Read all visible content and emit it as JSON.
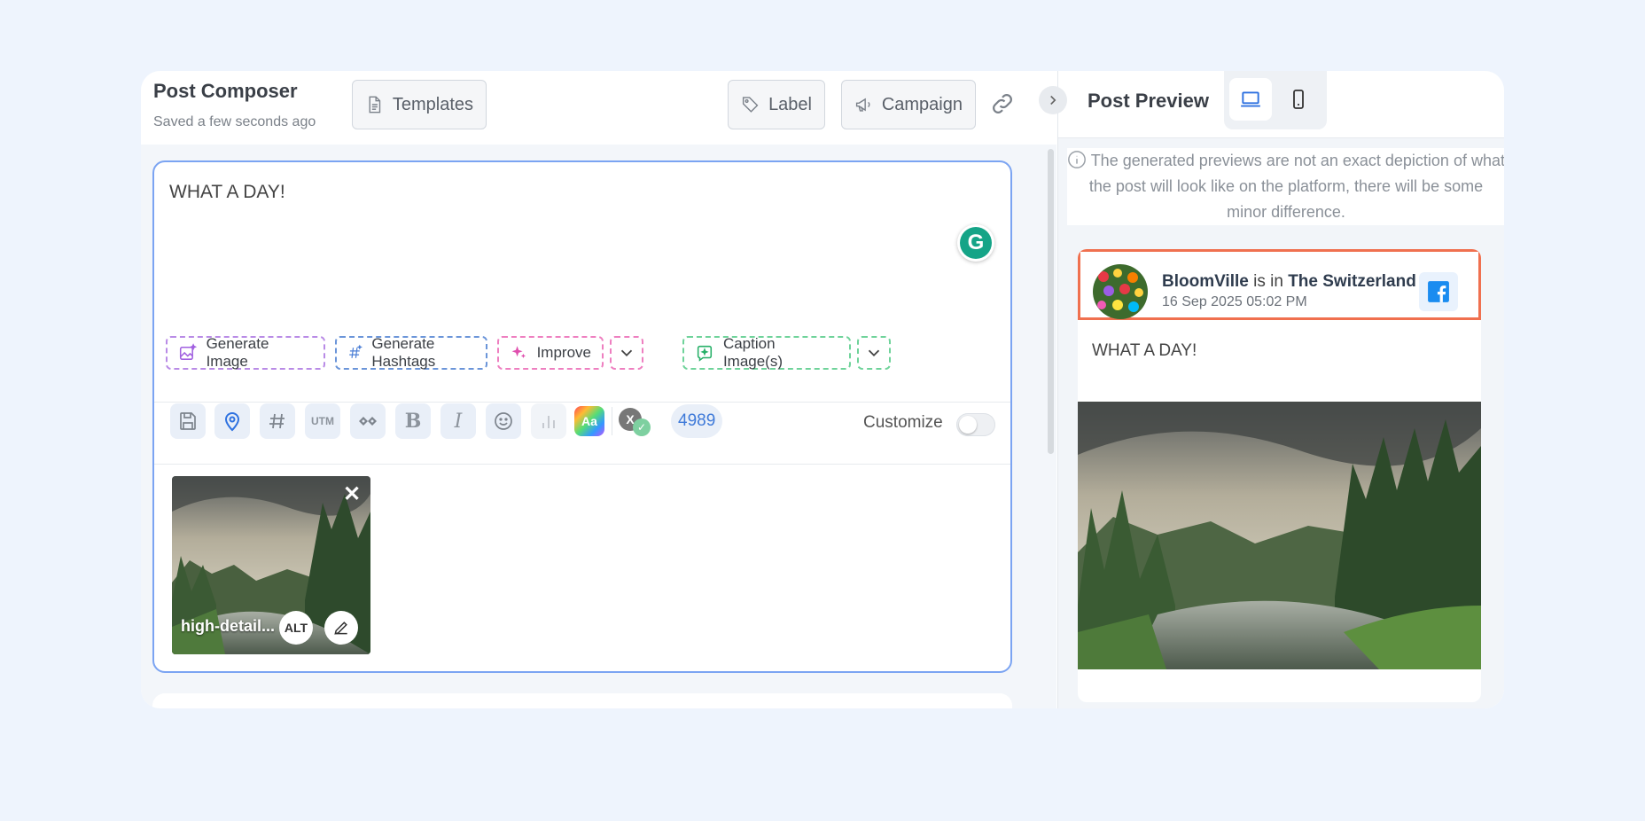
{
  "composer": {
    "title": "Post Composer",
    "saved_status": "Saved a few seconds ago",
    "templates_label": "Templates",
    "label_label": "Label",
    "campaign_label": "Campaign",
    "link_icon": "link-icon"
  },
  "editor": {
    "text": "WHAT A DAY!",
    "grammarly_icon": "grammarly-icon",
    "ai_actions": [
      {
        "label": "Generate Image",
        "icon": "ai-image-icon",
        "color": "#b98be6"
      },
      {
        "label": "Generate Hashtags",
        "icon": "ai-hashtag-icon",
        "color": "#6b95d9"
      },
      {
        "label": "Improve",
        "icon": "sparkle-icon",
        "color": "#ee7fc0"
      },
      {
        "label": "Caption Image(s)",
        "icon": "ai-caption-icon",
        "color": "#6fd39a"
      }
    ],
    "toolbar_icons": [
      "save-icon",
      "location-icon",
      "hashtag-icon",
      "utm-icon",
      "link-shortener-icon",
      "bold-icon",
      "italic-icon",
      "emoji-icon",
      "poll-icon",
      "font-style-icon",
      "x-verified-icon"
    ],
    "utm_text": "UTM",
    "char_count": "4989",
    "customize_label": "Customize",
    "customize_on": false,
    "media": {
      "filename": "high-detail...",
      "alt_label": "ALT"
    }
  },
  "preview": {
    "title": "Post Preview",
    "devices": [
      "desktop-icon",
      "mobile-icon"
    ],
    "active_device": "desktop",
    "notice": "The generated previews are not an exact depiction of what the post will look like on the platform, there will be some minor difference.",
    "card": {
      "account": "BloomVille",
      "is_in": "is in",
      "location": "The Switzerland",
      "date": "16 Sep 2025 05:02 PM",
      "platform_icon": "facebook-icon",
      "text": "WHAT A DAY!"
    }
  },
  "colors": {
    "accent": "#3f7ad9",
    "editor_border": "#7ba4f2",
    "highlight_border": "#f0704f",
    "facebook": "#1a8cf0",
    "page_bg": "#eef4fd"
  }
}
